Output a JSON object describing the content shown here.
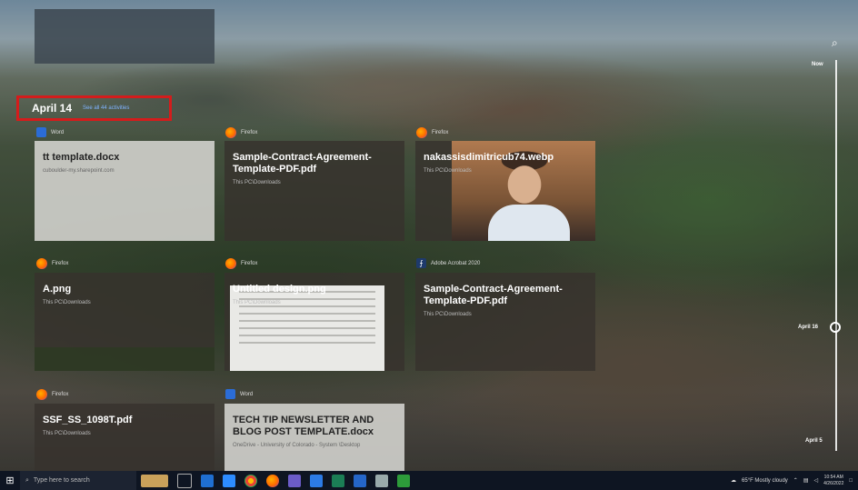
{
  "timeline": {
    "date_title": "April 14",
    "see_all_link": "See all 44 activities",
    "search_icon": "search-icon",
    "labels": {
      "now": "Now",
      "apr16": "April 16",
      "apr5": "April 5"
    }
  },
  "cards": [
    {
      "app": "Word",
      "icon": "word-icon",
      "title": "tt template.docx",
      "sub": "cuboulder-my.sharepoint.com"
    },
    {
      "app": "Firefox",
      "icon": "firefox-icon",
      "title": "Sample-Contract-Agreement-Template-PDF.pdf",
      "sub": "This PC\\Downloads"
    },
    {
      "app": "Firefox",
      "icon": "firefox-icon",
      "title": "nakassisdimitricub74.webp",
      "sub": "This PC\\Downloads"
    },
    {
      "app": "Firefox",
      "icon": "firefox-icon",
      "title": "A.png",
      "sub": "This PC\\Downloads"
    },
    {
      "app": "Firefox",
      "icon": "firefox-icon",
      "title": "Untitled design.png",
      "sub": "This PC\\Downloads"
    },
    {
      "app": "Adobe Acrobat 2020",
      "icon": "acrobat-icon",
      "title": "Sample-Contract-Agreement-Template-PDF.pdf",
      "sub": "This PC\\Downloads"
    },
    {
      "app": "Firefox",
      "icon": "firefox-icon",
      "title": "SSF_SS_1098T.pdf",
      "sub": "This PC\\Downloads"
    },
    {
      "app": "Word",
      "icon": "word-icon",
      "title": "TECH TIP NEWSLETTER AND BLOG POST TEMPLATE.docx",
      "sub": "OneDrive - University of Colorado - System \\Desktop"
    }
  ],
  "taskbar": {
    "search_placeholder": "Type here to search",
    "weather": "65°F  Mostly cloudy",
    "time": "10:54 AM",
    "date": "4/26/2022",
    "colors": {
      "bg": "#0e1522"
    }
  }
}
